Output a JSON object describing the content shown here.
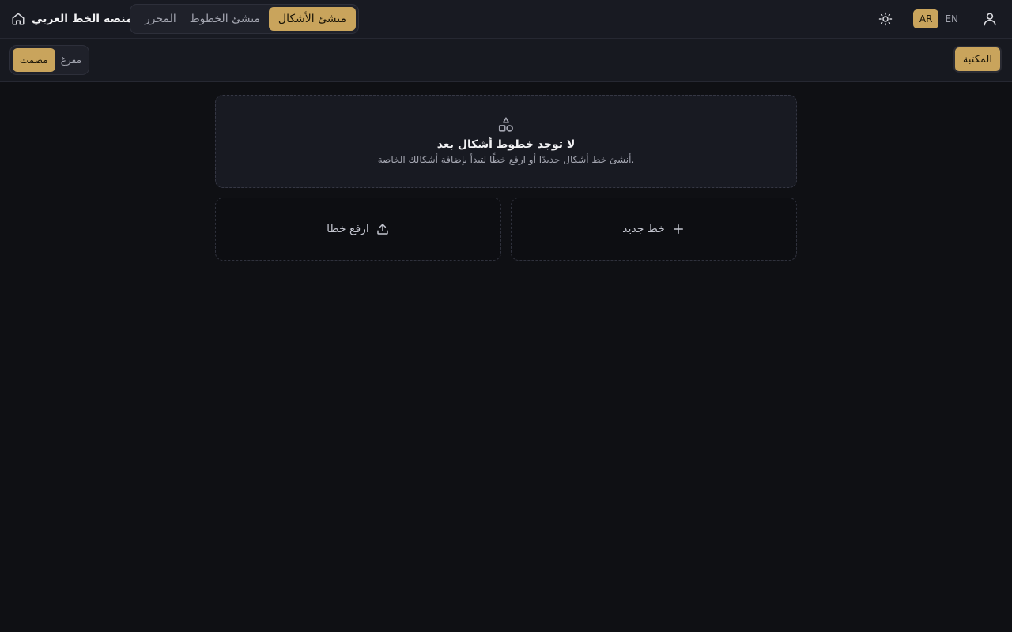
{
  "app": {
    "title": "منصة الخط العربي"
  },
  "nav": {
    "tabs": [
      {
        "label": "منشئ الأشكال",
        "active": true
      },
      {
        "label": "منشئ الخطوط",
        "active": false
      },
      {
        "label": "المحرر",
        "active": false
      }
    ]
  },
  "header_tools": {
    "lang_en": "EN",
    "lang_ar": "AR",
    "active_lang": "AR"
  },
  "toolbar": {
    "library_label": "المكتبة",
    "modes": [
      {
        "label": "مصمت",
        "active": true
      },
      {
        "label": "مفرغ",
        "active": false
      }
    ]
  },
  "empty_state": {
    "title": "لا توجد خطوط أشكال بعد",
    "description": "أنشئ خط أشكال جديدًا أو ارفع خطًا لتبدأ بإضافة أشكالك الخاصة."
  },
  "actions": {
    "new_font": "خط جديد",
    "upload_font": "ارفع خطا"
  },
  "colors": {
    "accent": "#c9a45c",
    "background": "#0f1014",
    "surface": "#181a22"
  }
}
